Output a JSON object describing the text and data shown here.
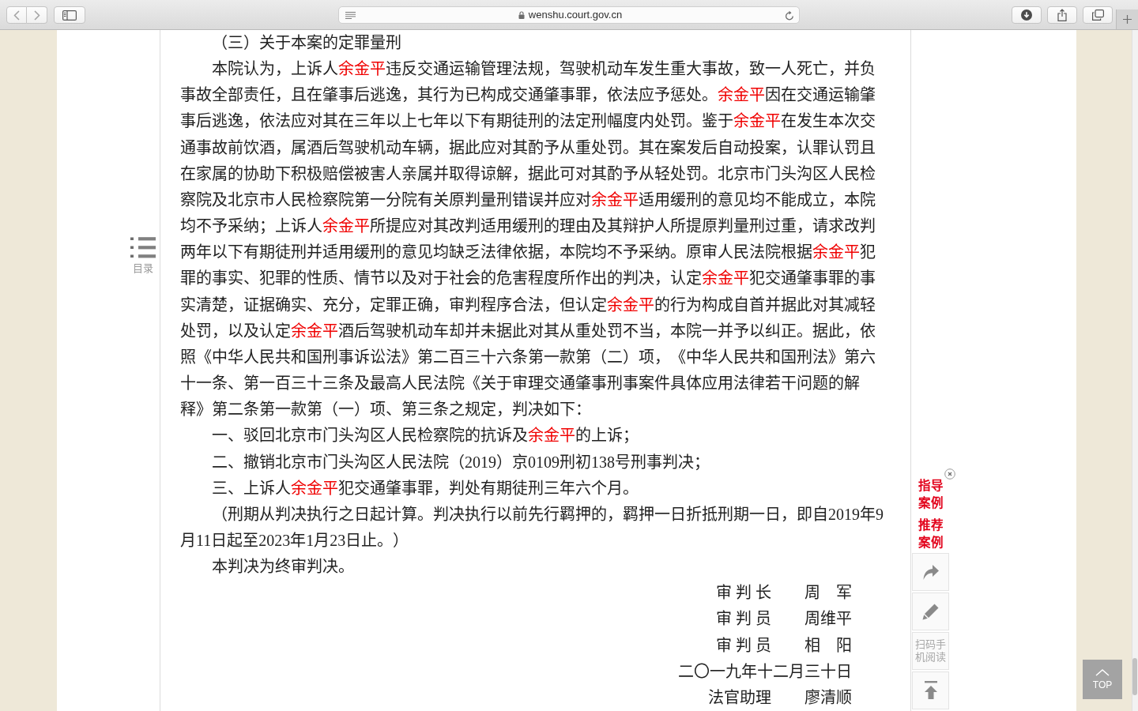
{
  "browser": {
    "url": "wenshu.court.gov.cn"
  },
  "toc": {
    "label": "目录"
  },
  "document": {
    "heading": "（三）关于本案的定罪量刑",
    "paragraphs": [
      {
        "segments": [
          {
            "text": "本院认为，上诉人",
            "highlighted": false
          },
          {
            "text": "余金平",
            "highlighted": true
          },
          {
            "text": "违反交通运输管理法规，驾驶机动车发生重大事故，致一人死亡，并负事故全部责任，且在肇事后逃逸，其行为已构成交通肇事罪，依法应予惩处。",
            "highlighted": false
          },
          {
            "text": "余金平",
            "highlighted": true
          },
          {
            "text": "因在交通运输肇事后逃逸，依法应对其在三年以上七年以下有期徒刑的法定刑幅度内处罚。鉴于",
            "highlighted": false
          },
          {
            "text": "余金平",
            "highlighted": true
          },
          {
            "text": "在发生本次交通事故前饮酒，属酒后驾驶机动车辆，据此应对其酌予从重处罚。其在案发后自动投案，认罪认罚且在家属的协助下积极赔偿被害人亲属并取得谅解，据此可对其酌予从轻处罚。北京市门头沟区人民检察院及北京市人民检察院第一分院有关原判量刑错误并应对",
            "highlighted": false
          },
          {
            "text": "余金平",
            "highlighted": true
          },
          {
            "text": "适用缓刑的意见均不能成立，本院均不予采纳；上诉人",
            "highlighted": false
          },
          {
            "text": "余金平",
            "highlighted": true
          },
          {
            "text": "所提应对其改判适用缓刑的理由及其辩护人所提原判量刑过重，请求改判两年以下有期徒刑并适用缓刑的意见均缺乏法律依据，本院均不予采纳。原审人民法院根据",
            "highlighted": false
          },
          {
            "text": "余金平",
            "highlighted": true
          },
          {
            "text": "犯罪的事实、犯罪的性质、情节以及对于社会的危害程度所作出的判决，认定",
            "highlighted": false
          },
          {
            "text": "余金平",
            "highlighted": true
          },
          {
            "text": "犯交通肇事罪的事实清楚，证据确实、充分，定罪正确，审判程序合法，但认定",
            "highlighted": false
          },
          {
            "text": "余金平",
            "highlighted": true
          },
          {
            "text": "的行为构成自首并据此对其减轻处罚，以及认定",
            "highlighted": false
          },
          {
            "text": "余金平",
            "highlighted": true
          },
          {
            "text": "酒后驾驶机动车却并未据此对其从重处罚不当，本院一并予以纠正。据此，依照《中华人民共和国刑事诉讼法》第二百三十六条第一款第（二）项，《中华人民共和国刑法》第六十一条、第一百三十三条及最高人民法院《关于审理交通肇事刑事案件具体应用法律若干问题的解释》第二条第一款第（一）项、第三条之规定，判决如下：",
            "highlighted": false
          }
        ]
      },
      {
        "segments": [
          {
            "text": "一、驳回北京市门头沟区人民检察院的抗诉及",
            "highlighted": false
          },
          {
            "text": "余金平",
            "highlighted": true
          },
          {
            "text": "的上诉；",
            "highlighted": false
          }
        ]
      },
      {
        "segments": [
          {
            "text": "二、撤销北京市门头沟区人民法院（2019）京0109刑初138号刑事判决；",
            "highlighted": false
          }
        ]
      },
      {
        "segments": [
          {
            "text": "三、上诉人",
            "highlighted": false
          },
          {
            "text": "余金平",
            "highlighted": true
          },
          {
            "text": "犯交通肇事罪，判处有期徒刑三年六个月。",
            "highlighted": false
          }
        ]
      },
      {
        "segments": [
          {
            "text": "（刑期从判决执行之日起计算。判决执行以前先行羁押的，羁押一日折抵刑期一日，即自2019年9月11日起至2023年1月23日止。）",
            "highlighted": false
          }
        ]
      },
      {
        "segments": [
          {
            "text": "本判决为终审判决。",
            "highlighted": false
          }
        ]
      }
    ],
    "signatures": [
      {
        "kind": "signer",
        "role": "审 判 长",
        "name": "周　军"
      },
      {
        "kind": "signer",
        "role": "审 判 员",
        "name": "周维平"
      },
      {
        "kind": "signer",
        "role": "审 判 员",
        "name": "相　阳"
      },
      {
        "kind": "date",
        "text": "二〇一九年十二月三十日"
      },
      {
        "kind": "signer",
        "role": "法官助理",
        "name": "廖清顺"
      }
    ]
  },
  "side_panel": {
    "links": [
      {
        "label": "指导案例"
      },
      {
        "label": "推荐案例"
      }
    ],
    "qr_label": "扫码手机阅读"
  },
  "back_to_top": {
    "label": "TOP"
  }
}
